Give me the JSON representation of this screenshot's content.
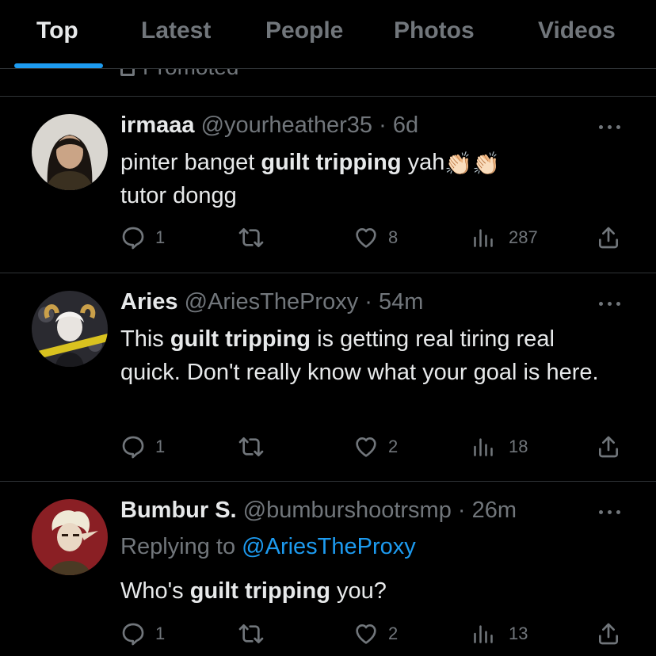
{
  "tabs": [
    {
      "label": "Top",
      "active": true
    },
    {
      "label": "Latest",
      "active": false
    },
    {
      "label": "People",
      "active": false
    },
    {
      "label": "Photos",
      "active": false
    },
    {
      "label": "Videos",
      "active": false
    }
  ],
  "promoted_label": "Promoted",
  "accent_color": "#1d9bf0",
  "tweets": [
    {
      "name": "irmaaa",
      "handle": "@yourheather35",
      "time": "6d",
      "text_parts": [
        "pinter banget ",
        "guilt tripping",
        " yah",
        "tutor dongg"
      ],
      "emoji": "👏🏻👏🏻",
      "replies": "1",
      "retweets": "",
      "likes": "8",
      "views": "287"
    },
    {
      "name": "Aries",
      "handle": "@AriesTheProxy",
      "time": "54m",
      "text_parts": [
        "This ",
        "guilt tripping",
        " is getting real tiring real quick. Don't really know what your goal is here."
      ],
      "replies": "1",
      "retweets": "",
      "likes": "2",
      "views": "18"
    },
    {
      "name": "Bumbur S.",
      "handle": "@bumburshootrsmp",
      "time": "26m",
      "replying_label": "Replying to",
      "replying_to": "@AriesTheProxy",
      "text_parts": [
        "Who's ",
        "guilt tripping",
        " you?"
      ],
      "replies": "1",
      "retweets": "",
      "likes": "2",
      "views": "13"
    }
  ],
  "icons": {
    "reply": "reply-icon",
    "retweet": "retweet-icon",
    "like": "heart-icon",
    "views": "views-icon",
    "share": "share-icon",
    "more": "more-icon"
  }
}
